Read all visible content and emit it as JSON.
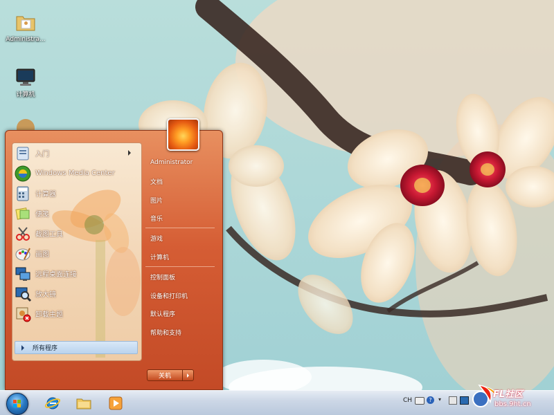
{
  "desktop": {
    "icons": [
      {
        "label": "Administra...",
        "icon": "user-folder-icon"
      },
      {
        "label": "计算机",
        "icon": "computer-icon"
      }
    ]
  },
  "start_menu": {
    "programs": [
      {
        "label": "入门",
        "icon": "getting-started-icon",
        "has_submenu": true
      },
      {
        "label": "Windows Media Center",
        "icon": "media-center-icon",
        "has_submenu": false
      },
      {
        "label": "计算器",
        "icon": "calculator-icon",
        "has_submenu": false
      },
      {
        "label": "便笺",
        "icon": "sticky-notes-icon",
        "has_submenu": false
      },
      {
        "label": "截图工具",
        "icon": "snipping-tool-icon",
        "has_submenu": false
      },
      {
        "label": "画图",
        "icon": "paint-icon",
        "has_submenu": false
      },
      {
        "label": "远程桌面连接",
        "icon": "remote-desktop-icon",
        "has_submenu": false
      },
      {
        "label": "放大镜",
        "icon": "magnifier-icon",
        "has_submenu": false
      },
      {
        "label": "卸载主题",
        "icon": "uninstall-theme-icon",
        "has_submenu": false
      }
    ],
    "all_programs": "所有程序",
    "user_name": "Administrator",
    "right_items": [
      {
        "label": "文档"
      },
      {
        "label": "图片"
      },
      {
        "label": "音乐"
      },
      {
        "label": "游戏"
      },
      {
        "label": "计算机"
      },
      {
        "label": "控制面板"
      },
      {
        "label": "设备和打印机"
      },
      {
        "label": "默认程序"
      },
      {
        "label": "帮助和支持"
      }
    ],
    "shutdown_label": "关机"
  },
  "taskbar": {
    "pinned": [
      {
        "icon": "internet-explorer-icon"
      },
      {
        "icon": "file-explorer-icon"
      },
      {
        "icon": "media-player-icon"
      }
    ],
    "tray_lang": "CH"
  },
  "watermark": {
    "brand": "FL社区",
    "url": "bbs.9ht.cn"
  },
  "colors": {
    "menu_accent": "#d55d34",
    "taskbar": "#ccd7e6"
  }
}
